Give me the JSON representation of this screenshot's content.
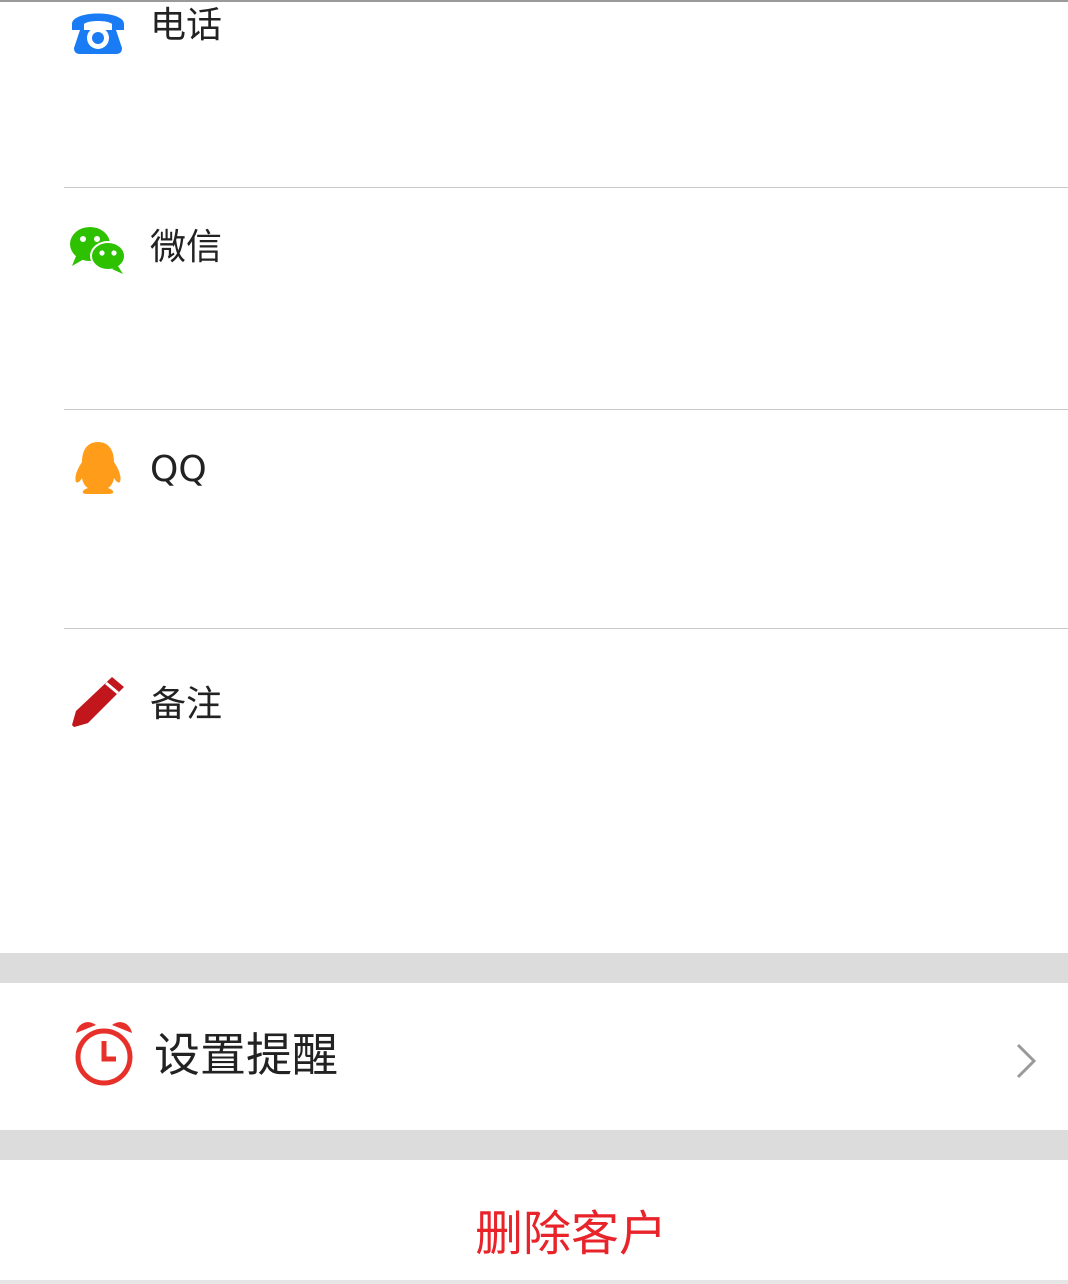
{
  "fields": [
    {
      "label": "电话",
      "icon": "phone-icon",
      "color": "#1a7cf5"
    },
    {
      "label": "微信",
      "icon": "wechat-icon",
      "color": "#2dc100"
    },
    {
      "label": "QQ",
      "icon": "qq-penguin-icon",
      "color": "#ff9d1a"
    },
    {
      "label": "备注",
      "icon": "pencil-icon",
      "color": "#c0161c"
    }
  ],
  "reminder": {
    "label": "设置提醒",
    "icon": "alarm-clock-icon",
    "color": "#e8302a"
  },
  "delete": {
    "label": "删除客户",
    "color": "#e8232a"
  },
  "colors": {
    "separator": "#dcdcdc",
    "divider": "#c8c8c8"
  }
}
